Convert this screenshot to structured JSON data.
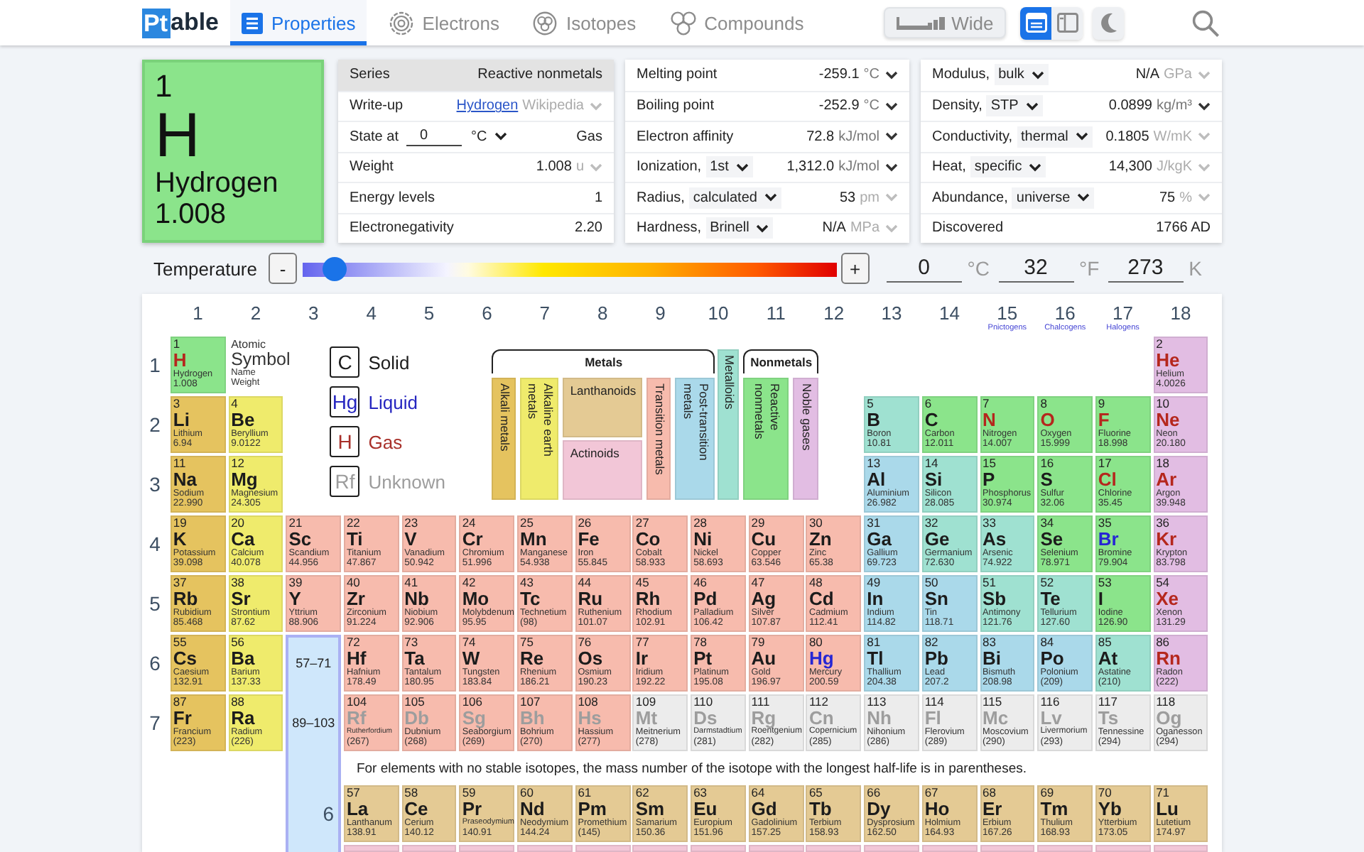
{
  "topbar": {
    "logo": {
      "mark": "Pt",
      "rest": "able"
    },
    "tabs": [
      {
        "label": "Properties",
        "selected": true
      },
      {
        "label": "Electrons",
        "selected": false
      },
      {
        "label": "Isotopes",
        "selected": false
      },
      {
        "label": "Compounds",
        "selected": false
      }
    ],
    "wide_button": {
      "label": "Wide"
    },
    "view_toggles": [
      {
        "selected": true
      },
      {
        "selected": false
      }
    ]
  },
  "element": {
    "number": "1",
    "symbol": "H",
    "name": "Hydrogen",
    "weight": "1.008",
    "color": "#8be48b"
  },
  "property_panels": [
    {
      "rows": [
        {
          "kind": "header",
          "label": "Series",
          "value": "Reactive nonmetals"
        },
        {
          "kind": "link",
          "label": "Write-up",
          "value": "Hydrogen",
          "unit": {
            "label": "Wikipedia",
            "disabled": true
          }
        },
        {
          "kind": "input",
          "label": "State at",
          "input": "0",
          "option": "°C",
          "value": "Gas"
        },
        {
          "kind": "plain",
          "label": "Weight",
          "value": "1.008",
          "unit": {
            "label": "u",
            "disabled": true
          }
        },
        {
          "kind": "plain",
          "label": "Energy levels",
          "value": "1"
        },
        {
          "kind": "plain",
          "label": "Electronegativity",
          "value": "2.20"
        }
      ]
    },
    {
      "rows": [
        {
          "kind": "plain",
          "label": "Melting point",
          "value": "-259.1",
          "unit": {
            "label": "°C",
            "disabled": false
          }
        },
        {
          "kind": "plain",
          "label": "Boiling point",
          "value": "-252.9",
          "unit": {
            "label": "°C",
            "disabled": false
          }
        },
        {
          "kind": "plain",
          "label": "Electron affinity",
          "value": "72.8",
          "unit": {
            "label": "kJ/mol",
            "disabled": false
          }
        },
        {
          "kind": "select",
          "label": "Ionization,",
          "option": "1st",
          "value": "1,312.0",
          "unit": {
            "label": "kJ/mol",
            "disabled": false
          }
        },
        {
          "kind": "select",
          "label": "Radius,",
          "option": "calculated",
          "value": "53",
          "unit": {
            "label": "pm",
            "disabled": true
          }
        },
        {
          "kind": "select",
          "label": "Hardness,",
          "option": "Brinell",
          "value": "N/A",
          "unit": {
            "label": "MPa",
            "disabled": true
          }
        }
      ]
    },
    {
      "rows": [
        {
          "kind": "select",
          "label": "Modulus,",
          "option": "bulk",
          "value": "N/A",
          "unit": {
            "label": "GPa",
            "disabled": true
          }
        },
        {
          "kind": "select",
          "label": "Density,",
          "option": "STP",
          "value": "0.0899",
          "unit": {
            "label": "kg/m³",
            "disabled": false
          }
        },
        {
          "kind": "select",
          "label": "Conductivity,",
          "option": "thermal",
          "value": "0.1805",
          "unit": {
            "label": "W/mK",
            "disabled": true
          }
        },
        {
          "kind": "select",
          "label": "Heat,",
          "option": "specific",
          "value": "14,300",
          "unit": {
            "label": "J/kgK",
            "disabled": true
          }
        },
        {
          "kind": "select",
          "label": "Abundance,",
          "option": "universe",
          "value": "75",
          "unit": {
            "label": "%",
            "disabled": true
          }
        },
        {
          "kind": "plain",
          "label": "Discovered",
          "value": "1766 AD"
        }
      ]
    }
  ],
  "temperature": {
    "label": "Temperature",
    "decrease": "-",
    "increase": "+",
    "level": 0.04,
    "readings": [
      {
        "value": "0",
        "unit": "°C"
      },
      {
        "value": "32",
        "unit": "°F"
      },
      {
        "value": "273",
        "unit": "K"
      }
    ]
  },
  "table": {
    "groups": [
      {
        "label": "1"
      },
      {
        "label": "2"
      },
      {
        "label": "3"
      },
      {
        "label": "4"
      },
      {
        "label": "5"
      },
      {
        "label": "6"
      },
      {
        "label": "7"
      },
      {
        "label": "8"
      },
      {
        "label": "9"
      },
      {
        "label": "10"
      },
      {
        "label": "11"
      },
      {
        "label": "12"
      },
      {
        "label": "13"
      },
      {
        "label": "14"
      },
      {
        "label": "15",
        "family": "Pnictogens"
      },
      {
        "label": "16",
        "family": "Chalcogens"
      },
      {
        "label": "17",
        "family": "Halogens"
      },
      {
        "label": "18"
      }
    ],
    "periods": [
      {
        "label": "1",
        "elements": [
          {
            "number": "1",
            "symbol": "H",
            "name": "Hydrogen",
            "weight": "1.008",
            "kind": "gas",
            "color": "#8be48b"
          },
          {
            "number": "2",
            "symbol": "He",
            "name": "Helium",
            "weight": "4.0026",
            "kind": "gas",
            "color": "#e2bde3"
          }
        ]
      },
      {
        "label": "2",
        "elements": [
          {
            "number": "3",
            "symbol": "Li",
            "name": "Lithium",
            "weight": "6.94",
            "kind": "solid",
            "color": "#e5c35f"
          },
          {
            "number": "4",
            "symbol": "Be",
            "name": "Beryllium",
            "weight": "9.0122",
            "kind": "solid",
            "color": "#efeb6c"
          },
          {
            "number": "5",
            "symbol": "B",
            "name": "Boron",
            "weight": "10.81",
            "kind": "solid",
            "color": "#9fe1d1"
          },
          {
            "number": "6",
            "symbol": "C",
            "name": "Carbon",
            "weight": "12.011",
            "kind": "solid",
            "color": "#8be48b"
          },
          {
            "number": "7",
            "symbol": "N",
            "name": "Nitrogen",
            "weight": "14.007",
            "kind": "gas",
            "color": "#8be48b"
          },
          {
            "number": "8",
            "symbol": "O",
            "name": "Oxygen",
            "weight": "15.999",
            "kind": "gas",
            "color": "#8be48b"
          },
          {
            "number": "9",
            "symbol": "F",
            "name": "Fluorine",
            "weight": "18.998",
            "kind": "gas",
            "color": "#8be48b"
          },
          {
            "number": "10",
            "symbol": "Ne",
            "name": "Neon",
            "weight": "20.180",
            "kind": "gas",
            "color": "#e2bde3"
          }
        ]
      },
      {
        "label": "3",
        "elements": [
          {
            "number": "11",
            "symbol": "Na",
            "name": "Sodium",
            "weight": "22.990",
            "kind": "solid",
            "color": "#e5c35f"
          },
          {
            "number": "12",
            "symbol": "Mg",
            "name": "Magnesium",
            "weight": "24.305",
            "kind": "solid",
            "color": "#efeb6c"
          },
          {
            "number": "13",
            "symbol": "Al",
            "name": "Aluminium",
            "weight": "26.982",
            "kind": "solid",
            "color": "#aad9ea"
          },
          {
            "number": "14",
            "symbol": "Si",
            "name": "Silicon",
            "weight": "28.085",
            "kind": "solid",
            "color": "#9fe1d1"
          },
          {
            "number": "15",
            "symbol": "P",
            "name": "Phosphorus",
            "weight": "30.974",
            "kind": "solid",
            "color": "#8be48b"
          },
          {
            "number": "16",
            "symbol": "S",
            "name": "Sulfur",
            "weight": "32.06",
            "kind": "solid",
            "color": "#8be48b"
          },
          {
            "number": "17",
            "symbol": "Cl",
            "name": "Chlorine",
            "weight": "35.45",
            "kind": "gas",
            "color": "#8be48b"
          },
          {
            "number": "18",
            "symbol": "Ar",
            "name": "Argon",
            "weight": "39.948",
            "kind": "gas",
            "color": "#e2bde3"
          }
        ]
      },
      {
        "label": "4",
        "elements": [
          {
            "number": "19",
            "symbol": "K",
            "name": "Potassium",
            "weight": "39.098",
            "kind": "solid",
            "color": "#e5c35f"
          },
          {
            "number": "20",
            "symbol": "Ca",
            "name": "Calcium",
            "weight": "40.078",
            "kind": "solid",
            "color": "#efeb6c"
          },
          {
            "number": "21",
            "symbol": "Sc",
            "name": "Scandium",
            "weight": "44.956",
            "kind": "solid",
            "color": "#f7bbad"
          },
          {
            "number": "22",
            "symbol": "Ti",
            "name": "Titanium",
            "weight": "47.867",
            "kind": "solid",
            "color": "#f7bbad"
          },
          {
            "number": "23",
            "symbol": "V",
            "name": "Vanadium",
            "weight": "50.942",
            "kind": "solid",
            "color": "#f7bbad"
          },
          {
            "number": "24",
            "symbol": "Cr",
            "name": "Chromium",
            "weight": "51.996",
            "kind": "solid",
            "color": "#f7bbad"
          },
          {
            "number": "25",
            "symbol": "Mn",
            "name": "Manganese",
            "weight": "54.938",
            "kind": "solid",
            "color": "#f7bbad"
          },
          {
            "number": "26",
            "symbol": "Fe",
            "name": "Iron",
            "weight": "55.845",
            "kind": "solid",
            "color": "#f7bbad"
          },
          {
            "number": "27",
            "symbol": "Co",
            "name": "Cobalt",
            "weight": "58.933",
            "kind": "solid",
            "color": "#f7bbad"
          },
          {
            "number": "28",
            "symbol": "Ni",
            "name": "Nickel",
            "weight": "58.693",
            "kind": "solid",
            "color": "#f7bbad"
          },
          {
            "number": "29",
            "symbol": "Cu",
            "name": "Copper",
            "weight": "63.546",
            "kind": "solid",
            "color": "#f7bbad"
          },
          {
            "number": "30",
            "symbol": "Zn",
            "name": "Zinc",
            "weight": "65.38",
            "kind": "solid",
            "color": "#f7bbad"
          },
          {
            "number": "31",
            "symbol": "Ga",
            "name": "Gallium",
            "weight": "69.723",
            "kind": "solid",
            "color": "#aad9ea"
          },
          {
            "number": "32",
            "symbol": "Ge",
            "name": "Germanium",
            "weight": "72.630",
            "kind": "solid",
            "color": "#9fe1d1"
          },
          {
            "number": "33",
            "symbol": "As",
            "name": "Arsenic",
            "weight": "74.922",
            "kind": "solid",
            "color": "#9fe1d1"
          },
          {
            "number": "34",
            "symbol": "Se",
            "name": "Selenium",
            "weight": "78.971",
            "kind": "solid",
            "color": "#8be48b"
          },
          {
            "number": "35",
            "symbol": "Br",
            "name": "Bromine",
            "weight": "79.904",
            "kind": "liquid",
            "color": "#8be48b"
          },
          {
            "number": "36",
            "symbol": "Kr",
            "name": "Krypton",
            "weight": "83.798",
            "kind": "gas",
            "color": "#e2bde3"
          }
        ]
      },
      {
        "label": "5",
        "elements": [
          {
            "number": "37",
            "symbol": "Rb",
            "name": "Rubidium",
            "weight": "85.468",
            "kind": "solid",
            "color": "#e5c35f"
          },
          {
            "number": "38",
            "symbol": "Sr",
            "name": "Strontium",
            "weight": "87.62",
            "kind": "solid",
            "color": "#efeb6c"
          },
          {
            "number": "39",
            "symbol": "Y",
            "name": "Yttrium",
            "weight": "88.906",
            "kind": "solid",
            "color": "#f7bbad"
          },
          {
            "number": "40",
            "symbol": "Zr",
            "name": "Zirconium",
            "weight": "91.224",
            "kind": "solid",
            "color": "#f7bbad"
          },
          {
            "number": "41",
            "symbol": "Nb",
            "name": "Niobium",
            "weight": "92.906",
            "kind": "solid",
            "color": "#f7bbad"
          },
          {
            "number": "42",
            "symbol": "Mo",
            "name": "Molybdenum",
            "weight": "95.95",
            "kind": "solid",
            "color": "#f7bbad"
          },
          {
            "number": "43",
            "symbol": "Tc",
            "name": "Technetium",
            "weight": "(98)",
            "kind": "solid",
            "color": "#f7bbad"
          },
          {
            "number": "44",
            "symbol": "Ru",
            "name": "Ruthenium",
            "weight": "101.07",
            "kind": "solid",
            "color": "#f7bbad"
          },
          {
            "number": "45",
            "symbol": "Rh",
            "name": "Rhodium",
            "weight": "102.91",
            "kind": "solid",
            "color": "#f7bbad"
          },
          {
            "number": "46",
            "symbol": "Pd",
            "name": "Palladium",
            "weight": "106.42",
            "kind": "solid",
            "color": "#f7bbad"
          },
          {
            "number": "47",
            "symbol": "Ag",
            "name": "Silver",
            "weight": "107.87",
            "kind": "solid",
            "color": "#f7bbad"
          },
          {
            "number": "48",
            "symbol": "Cd",
            "name": "Cadmium",
            "weight": "112.41",
            "kind": "solid",
            "color": "#f7bbad"
          },
          {
            "number": "49",
            "symbol": "In",
            "name": "Indium",
            "weight": "114.82",
            "kind": "solid",
            "color": "#aad9ea"
          },
          {
            "number": "50",
            "symbol": "Sn",
            "name": "Tin",
            "weight": "118.71",
            "kind": "solid",
            "color": "#aad9ea"
          },
          {
            "number": "51",
            "symbol": "Sb",
            "name": "Antimony",
            "weight": "121.76",
            "kind": "solid",
            "color": "#9fe1d1"
          },
          {
            "number": "52",
            "symbol": "Te",
            "name": "Tellurium",
            "weight": "127.60",
            "kind": "solid",
            "color": "#9fe1d1"
          },
          {
            "number": "53",
            "symbol": "I",
            "name": "Iodine",
            "weight": "126.90",
            "kind": "solid",
            "color": "#8be48b"
          },
          {
            "number": "54",
            "symbol": "Xe",
            "name": "Xenon",
            "weight": "131.29",
            "kind": "gas",
            "color": "#e2bde3"
          }
        ]
      },
      {
        "label": "6",
        "elements": [
          {
            "number": "55",
            "symbol": "Cs",
            "name": "Caesium",
            "weight": "132.91",
            "kind": "solid",
            "color": "#e5c35f"
          },
          {
            "number": "56",
            "symbol": "Ba",
            "name": "Barium",
            "weight": "137.33",
            "kind": "solid",
            "color": "#efeb6c"
          },
          {
            "number": "72",
            "symbol": "Hf",
            "name": "Hafnium",
            "weight": "178.49",
            "kind": "solid",
            "color": "#f7bbad"
          },
          {
            "number": "73",
            "symbol": "Ta",
            "name": "Tantalum",
            "weight": "180.95",
            "kind": "solid",
            "color": "#f7bbad"
          },
          {
            "number": "74",
            "symbol": "W",
            "name": "Tungsten",
            "weight": "183.84",
            "kind": "solid",
            "color": "#f7bbad"
          },
          {
            "number": "75",
            "symbol": "Re",
            "name": "Rhenium",
            "weight": "186.21",
            "kind": "solid",
            "color": "#f7bbad"
          },
          {
            "number": "76",
            "symbol": "Os",
            "name": "Osmium",
            "weight": "190.23",
            "kind": "solid",
            "color": "#f7bbad"
          },
          {
            "number": "77",
            "symbol": "Ir",
            "name": "Iridium",
            "weight": "192.22",
            "kind": "solid",
            "color": "#f7bbad"
          },
          {
            "number": "78",
            "symbol": "Pt",
            "name": "Platinum",
            "weight": "195.08",
            "kind": "solid",
            "color": "#f7bbad"
          },
          {
            "number": "79",
            "symbol": "Au",
            "name": "Gold",
            "weight": "196.97",
            "kind": "solid",
            "color": "#f7bbad"
          },
          {
            "number": "80",
            "symbol": "Hg",
            "name": "Mercury",
            "weight": "200.59",
            "kind": "liquid",
            "color": "#f7bbad"
          },
          {
            "number": "81",
            "symbol": "Tl",
            "name": "Thallium",
            "weight": "204.38",
            "kind": "solid",
            "color": "#aad9ea"
          },
          {
            "number": "82",
            "symbol": "Pb",
            "name": "Lead",
            "weight": "207.2",
            "kind": "solid",
            "color": "#aad9ea"
          },
          {
            "number": "83",
            "symbol": "Bi",
            "name": "Bismuth",
            "weight": "208.98",
            "kind": "solid",
            "color": "#aad9ea"
          },
          {
            "number": "84",
            "symbol": "Po",
            "name": "Polonium",
            "weight": "(209)",
            "kind": "solid",
            "color": "#aad9ea"
          },
          {
            "number": "85",
            "symbol": "At",
            "name": "Astatine",
            "weight": "(210)",
            "kind": "solid",
            "color": "#9fe1d1"
          },
          {
            "number": "86",
            "symbol": "Rn",
            "name": "Radon",
            "weight": "(222)",
            "kind": "gas",
            "color": "#e2bde3"
          }
        ]
      },
      {
        "label": "7",
        "elements": [
          {
            "number": "87",
            "symbol": "Fr",
            "name": "Francium",
            "weight": "(223)",
            "kind": "solid",
            "color": "#e5c35f"
          },
          {
            "number": "88",
            "symbol": "Ra",
            "name": "Radium",
            "weight": "(226)",
            "kind": "solid",
            "color": "#efeb6c"
          },
          {
            "number": "104",
            "symbol": "Rf",
            "name": "Rutherfordium",
            "weight": "(267)",
            "kind": "unknown",
            "color": "#f7bbad"
          },
          {
            "number": "105",
            "symbol": "Db",
            "name": "Dubnium",
            "weight": "(268)",
            "kind": "unknown",
            "color": "#f7bbad"
          },
          {
            "number": "106",
            "symbol": "Sg",
            "name": "Seaborgium",
            "weight": "(269)",
            "kind": "unknown",
            "color": "#f7bbad"
          },
          {
            "number": "107",
            "symbol": "Bh",
            "name": "Bohrium",
            "weight": "(270)",
            "kind": "unknown",
            "color": "#f7bbad"
          },
          {
            "number": "108",
            "symbol": "Hs",
            "name": "Hassium",
            "weight": "(277)",
            "kind": "unknown",
            "color": "#f7bbad"
          },
          {
            "number": "109",
            "symbol": "Mt",
            "name": "Meitnerium",
            "weight": "(278)",
            "kind": "unknown",
            "color": "#ececec"
          },
          {
            "number": "110",
            "symbol": "Ds",
            "name": "Darmstadtium",
            "weight": "(281)",
            "kind": "unknown",
            "color": "#ececec"
          },
          {
            "number": "111",
            "symbol": "Rg",
            "name": "Roentgenium",
            "weight": "(282)",
            "kind": "unknown",
            "color": "#ececec"
          },
          {
            "number": "112",
            "symbol": "Cn",
            "name": "Copernicium",
            "weight": "(285)",
            "kind": "unknown",
            "color": "#ececec"
          },
          {
            "number": "113",
            "symbol": "Nh",
            "name": "Nihonium",
            "weight": "(286)",
            "kind": "unknown",
            "color": "#ececec"
          },
          {
            "number": "114",
            "symbol": "Fl",
            "name": "Flerovium",
            "weight": "(289)",
            "kind": "unknown",
            "color": "#ececec"
          },
          {
            "number": "115",
            "symbol": "Mc",
            "name": "Moscovium",
            "weight": "(290)",
            "kind": "unknown",
            "color": "#ececec"
          },
          {
            "number": "116",
            "symbol": "Lv",
            "name": "Livermorium",
            "weight": "(293)",
            "kind": "unknown",
            "color": "#ececec"
          },
          {
            "number": "117",
            "symbol": "Ts",
            "name": "Tennessine",
            "weight": "(294)",
            "kind": "unknown",
            "color": "#ececec"
          },
          {
            "number": "118",
            "symbol": "Og",
            "name": "Oganesson",
            "weight": "(294)",
            "kind": "unknown",
            "color": "#ececec"
          }
        ]
      }
    ],
    "key": {
      "atomic": "Atomic",
      "symbol": "Symbol",
      "name": "Name",
      "weight": "Weight"
    },
    "state_legend": [
      {
        "symbol": "C",
        "label": "Solid",
        "kind": "solid"
      },
      {
        "symbol": "Hg",
        "label": "Liquid",
        "kind": "liquid"
      },
      {
        "symbol": "H",
        "label": "Gas",
        "kind": "gas"
      },
      {
        "symbol": "Rf",
        "label": "Unknown",
        "kind": "unknown"
      }
    ],
    "series_legend": {
      "metals": "Metals",
      "nonmetals": "Nonmetals",
      "series": [
        {
          "label": "Alkali metals",
          "color": "#e5c35f"
        },
        {
          "label": "Alkaline earth metals",
          "color": "#efeb6c"
        },
        {
          "label": "Lanthanoids",
          "color": "#e4ca94"
        },
        {
          "label": "Actinoids",
          "color": "#f2c6d7"
        },
        {
          "label": "Transition metals",
          "color": "#f7bbad"
        },
        {
          "label": "Post-transition metals",
          "color": "#aad9ea"
        },
        {
          "label": "Metalloids",
          "color": "#9fe1d1"
        },
        {
          "label": "Reactive nonmetals",
          "color": "#8be48b"
        },
        {
          "label": "Noble gases",
          "color": "#e2bde3"
        }
      ]
    },
    "ranges": [
      {
        "label": "57–71"
      },
      {
        "label": "89–103"
      }
    ],
    "footnote": "For elements with no stable isotopes, the mass number of the isotope with the longest half-life is in parentheses.",
    "lanthanides": {
      "label": "6",
      "elements": [
        {
          "number": "57",
          "symbol": "La",
          "name": "Lanthanum",
          "weight": "138.91",
          "kind": "solid",
          "color": "#e4ca94"
        },
        {
          "number": "58",
          "symbol": "Ce",
          "name": "Cerium",
          "weight": "140.12",
          "kind": "solid",
          "color": "#e4ca94"
        },
        {
          "number": "59",
          "symbol": "Pr",
          "name": "Praseodymium",
          "weight": "140.91",
          "kind": "solid",
          "color": "#e4ca94"
        },
        {
          "number": "60",
          "symbol": "Nd",
          "name": "Neodymium",
          "weight": "144.24",
          "kind": "solid",
          "color": "#e4ca94"
        },
        {
          "number": "61",
          "symbol": "Pm",
          "name": "Promethium",
          "weight": "(145)",
          "kind": "solid",
          "color": "#e4ca94"
        },
        {
          "number": "62",
          "symbol": "Sm",
          "name": "Samarium",
          "weight": "150.36",
          "kind": "solid",
          "color": "#e4ca94"
        },
        {
          "number": "63",
          "symbol": "Eu",
          "name": "Europium",
          "weight": "151.96",
          "kind": "solid",
          "color": "#e4ca94"
        },
        {
          "number": "64",
          "symbol": "Gd",
          "name": "Gadolinium",
          "weight": "157.25",
          "kind": "solid",
          "color": "#e4ca94"
        },
        {
          "number": "65",
          "symbol": "Tb",
          "name": "Terbium",
          "weight": "158.93",
          "kind": "solid",
          "color": "#e4ca94"
        },
        {
          "number": "66",
          "symbol": "Dy",
          "name": "Dysprosium",
          "weight": "162.50",
          "kind": "solid",
          "color": "#e4ca94"
        },
        {
          "number": "67",
          "symbol": "Ho",
          "name": "Holmium",
          "weight": "164.93",
          "kind": "solid",
          "color": "#e4ca94"
        },
        {
          "number": "68",
          "symbol": "Er",
          "name": "Erbium",
          "weight": "167.26",
          "kind": "solid",
          "color": "#e4ca94"
        },
        {
          "number": "69",
          "symbol": "Tm",
          "name": "Thulium",
          "weight": "168.93",
          "kind": "solid",
          "color": "#e4ca94"
        },
        {
          "number": "70",
          "symbol": "Yb",
          "name": "Ytterbium",
          "weight": "173.05",
          "kind": "solid",
          "color": "#e4ca94"
        },
        {
          "number": "71",
          "symbol": "Lu",
          "name": "Lutetium",
          "weight": "174.97",
          "kind": "solid",
          "color": "#e4ca94"
        }
      ]
    },
    "actinides": {
      "tiles": [
        {
          "color": "#f2c6d7"
        },
        {
          "color": "#f2c6d7"
        },
        {
          "color": "#f2c6d7"
        },
        {
          "color": "#f2c6d7"
        },
        {
          "color": "#f2c6d7"
        },
        {
          "color": "#f2c6d7"
        },
        {
          "color": "#f2c6d7"
        },
        {
          "color": "#f2c6d7"
        },
        {
          "color": "#f2c6d7"
        },
        {
          "color": "#f2c6d7"
        },
        {
          "color": "#f2c6d7"
        },
        {
          "color": "#f2c6d7"
        },
        {
          "color": "#f2c6d7"
        },
        {
          "color": "#f2c6d7"
        },
        {
          "color": "#f2c6d7"
        }
      ]
    }
  }
}
